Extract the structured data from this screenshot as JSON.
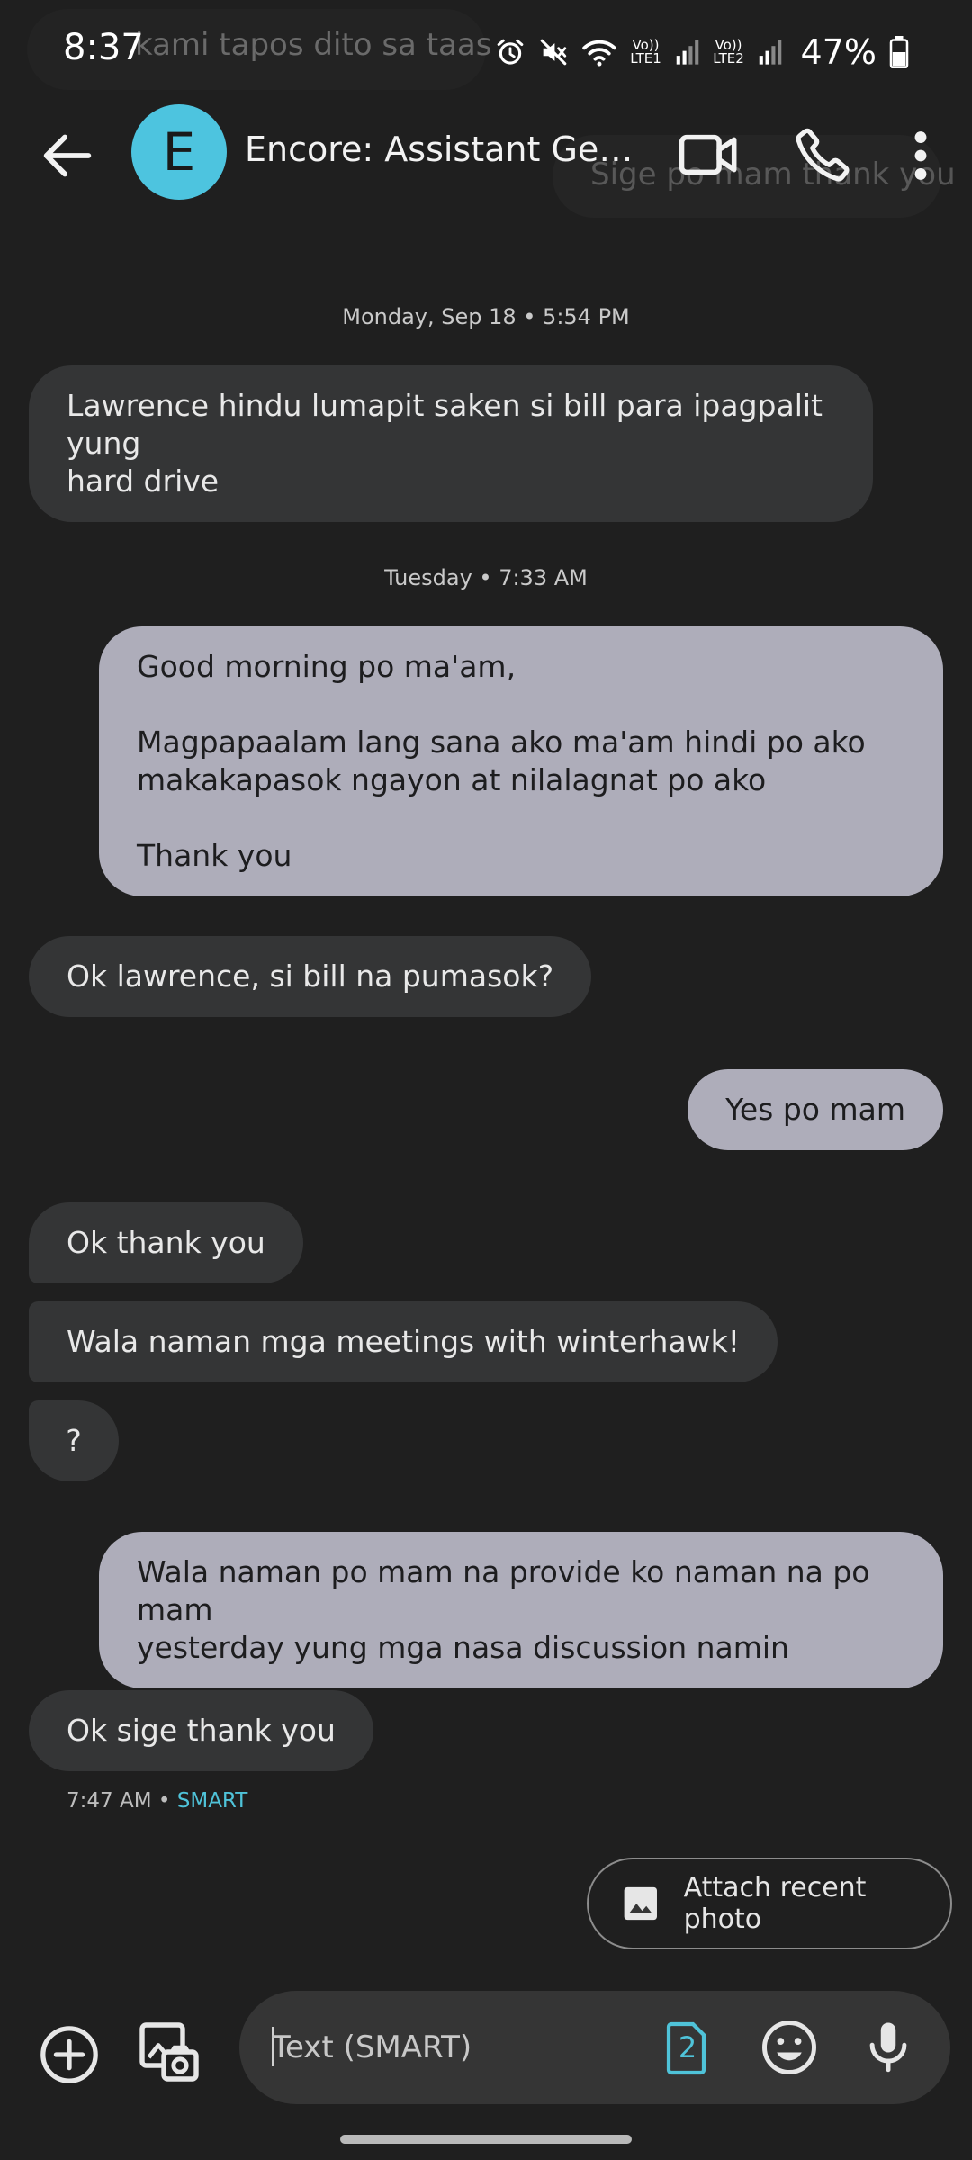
{
  "status_bar": {
    "time": "8:37",
    "battery": "47%",
    "sim1_label": "Vo)) LTE1",
    "sim2_label": "Vo)) LTE2",
    "ghost_text": "kami tapos dito sa taas"
  },
  "header": {
    "avatar_letter": "E",
    "contact_name": "Encore: Assistant Gener...",
    "ghost_text": "Sige po mam thank you"
  },
  "dates": {
    "first": "Monday, Sep 18 • 5:54 PM",
    "second": "Tuesday • 7:33 AM"
  },
  "messages": [
    {
      "direction": "incoming",
      "text": "Lawrence hindu lumapit saken si bill para ipagpalit yung\nhard drive"
    },
    {
      "direction": "outgoing",
      "text": "Good morning po ma'am,\n\nMagpapaalam lang sana ako ma'am hindi po ako\nmakakapasok ngayon at nilalagnat po ako\n\nThank you"
    },
    {
      "direction": "incoming",
      "text": "Ok lawrence, si bill na pumasok?"
    },
    {
      "direction": "outgoing",
      "text": "Yes po mam"
    },
    {
      "direction": "incoming",
      "text": "Ok thank you"
    },
    {
      "direction": "incoming",
      "text": "Wala naman mga meetings with winterhawk!"
    },
    {
      "direction": "incoming",
      "text": "?"
    },
    {
      "direction": "outgoing",
      "text": "Wala naman po mam na provide ko naman na po mam\nyesterday yung mga nasa discussion namin"
    },
    {
      "direction": "incoming",
      "text": "Ok sige thank you"
    }
  ],
  "last_meta": {
    "time": "7:47 AM",
    "separator": " • ",
    "carrier": "SMART"
  },
  "attach_chip": {
    "label": "Attach recent photo"
  },
  "compose": {
    "placeholder": "Text (SMART)",
    "sim_number": "2"
  },
  "colors": {
    "background": "#1f1f1f",
    "incoming_bubble": "#343536",
    "outgoing_bubble": "#aeadba",
    "avatar": "#4dc4df",
    "accent": "#4fc3d9"
  }
}
